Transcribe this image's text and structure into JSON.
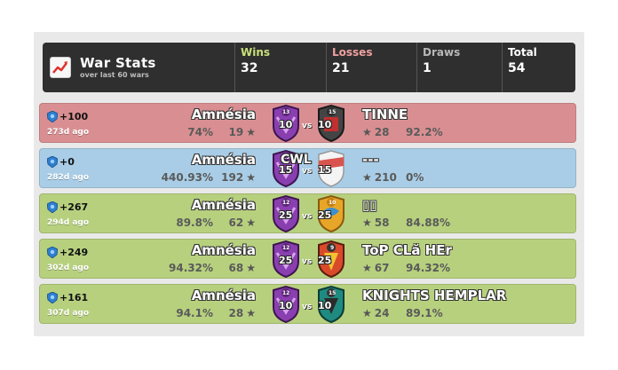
{
  "header": {
    "title": "War Stats",
    "subtitle": "over last 60 wars",
    "stats": [
      {
        "label": "Wins",
        "value": "32",
        "color": "#c8e07a"
      },
      {
        "label": "Losses",
        "value": "21",
        "color": "#f0a0a0"
      },
      {
        "label": "Draws",
        "value": "1",
        "color": "#b8b8b8"
      },
      {
        "label": "Total",
        "value": "54",
        "color": "#ffffff"
      }
    ]
  },
  "wars": [
    {
      "result": "lose",
      "trophies": "+100",
      "ago": "273d ago",
      "clan": "Amnésia",
      "clan_pct": "74%",
      "clan_stars": "19",
      "clan_badge_level": "13",
      "clan_destroyed": "10",
      "vs": "vs",
      "opp_destroyed": "10",
      "opp_badge_level": "15",
      "opponent": "TINNE",
      "opp_stars": "28",
      "opp_pct": "92.2%",
      "overlay": ""
    },
    {
      "result": "draw",
      "trophies": "+0",
      "ago": "282d ago",
      "clan": "Amnésia",
      "clan_pct": "440.93%",
      "clan_stars": "192",
      "clan_badge_level": "13",
      "clan_destroyed": "15",
      "vs": "vs",
      "opp_destroyed": "15",
      "opp_badge_level": "",
      "opponent": "---",
      "opp_stars": "210",
      "opp_pct": "0%",
      "overlay": "CWL"
    },
    {
      "result": "win",
      "trophies": "+267",
      "ago": "294d ago",
      "clan": "Amnésia",
      "clan_pct": "89.8%",
      "clan_stars": "62",
      "clan_badge_level": "12",
      "clan_destroyed": "25",
      "vs": "vs",
      "opp_destroyed": "25",
      "opp_badge_level": "10",
      "opponent": "▯▯",
      "opp_stars": "58",
      "opp_pct": "84.88%",
      "overlay": ""
    },
    {
      "result": "win",
      "trophies": "+249",
      "ago": "302d ago",
      "clan": "Amnésia",
      "clan_pct": "94.32%",
      "clan_stars": "68",
      "clan_badge_level": "12",
      "clan_destroyed": "25",
      "vs": "vs",
      "opp_destroyed": "25",
      "opp_badge_level": "9",
      "opponent": "ToP CLă HEr",
      "opp_stars": "67",
      "opp_pct": "94.32%",
      "overlay": ""
    },
    {
      "result": "win",
      "trophies": "+161",
      "ago": "307d ago",
      "clan": "Amnésia",
      "clan_pct": "94.1%",
      "clan_stars": "28",
      "clan_badge_level": "12",
      "clan_destroyed": "10",
      "vs": "vs",
      "opp_destroyed": "10",
      "opp_badge_level": "15",
      "opponent": "KNIGHTS HEMPLAR",
      "opp_stars": "24",
      "opp_pct": "89.1%",
      "overlay": ""
    }
  ],
  "icons": {
    "trophy": "trophy-icon",
    "star": "star-icon",
    "chart": "chart-icon"
  },
  "colors": {
    "lose": "#d98f92",
    "draw": "#a9cde6",
    "win": "#b7d07e",
    "header": "#2f2f2f",
    "clan_badge": "#8a3fb0"
  }
}
